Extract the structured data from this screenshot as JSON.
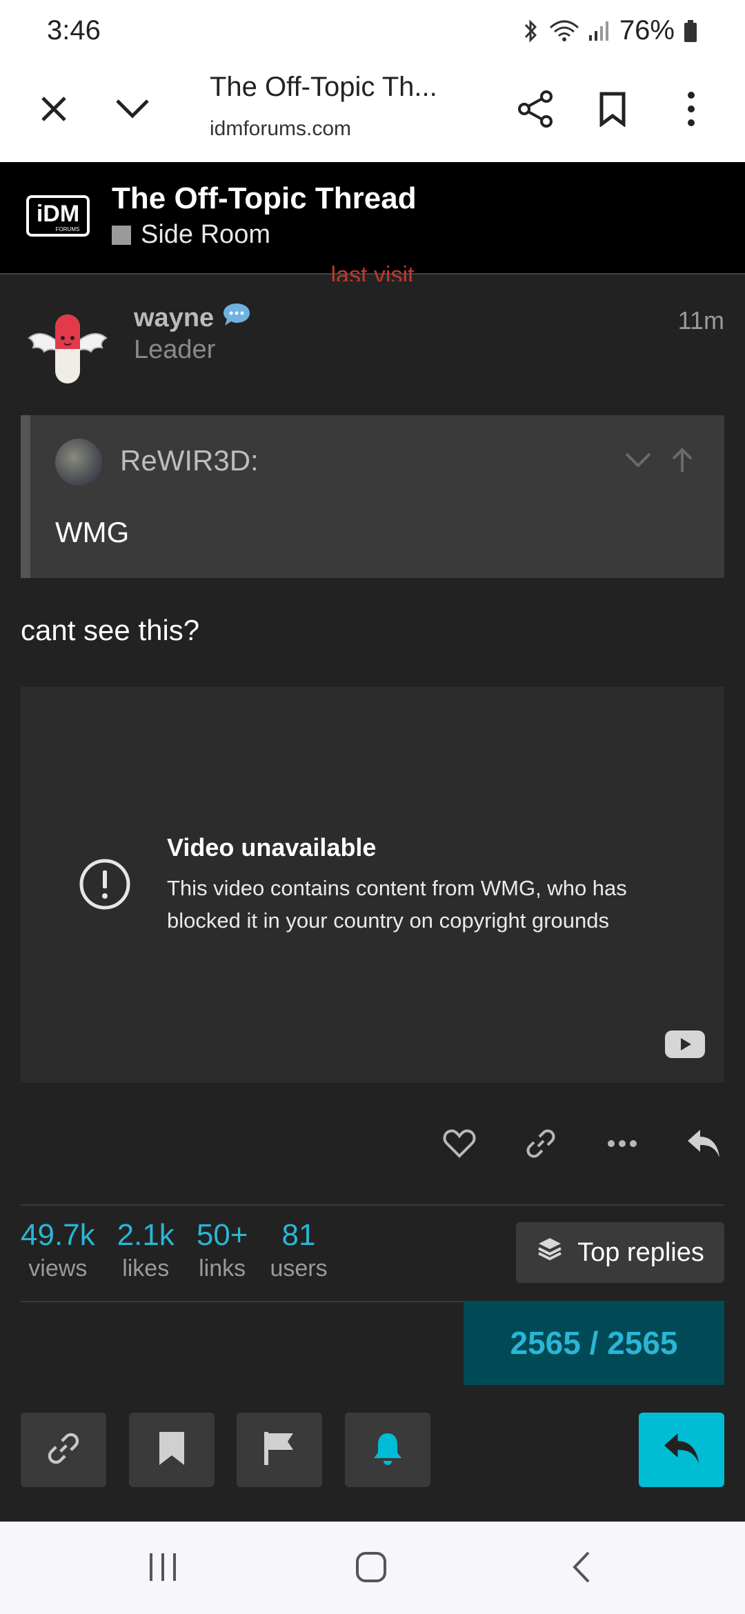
{
  "status_bar": {
    "time": "3:46",
    "battery": "76%"
  },
  "browser": {
    "title": "The Off-Topic Th...",
    "url": "idmforums.com"
  },
  "forum": {
    "logo_text": "iDM",
    "logo_sub": "FORUMS",
    "thread_title": "The Off-Topic Thread",
    "category": "Side Room",
    "category_color": "#9a9a9a",
    "last_visit": "last visit"
  },
  "post": {
    "username": "wayne",
    "user_title": "Leader",
    "time": "11m",
    "quote": {
      "author": "ReWIR3D:",
      "text": "WMG"
    },
    "body": "cant see this?",
    "video": {
      "title": "Video unavailable",
      "description": "This video contains content from WMG, who has blocked it in your country on copyright grounds"
    }
  },
  "stats": [
    {
      "value": "49.7k",
      "label": "views"
    },
    {
      "value": "2.1k",
      "label": "likes"
    },
    {
      "value": "50+",
      "label": "links"
    },
    {
      "value": "81",
      "label": "users"
    }
  ],
  "top_replies_label": "Top replies",
  "progress_label": "2565 / 2565",
  "colors": {
    "accent": "#2bb5d6",
    "reply_button": "#00bcd4",
    "background": "#222222"
  }
}
